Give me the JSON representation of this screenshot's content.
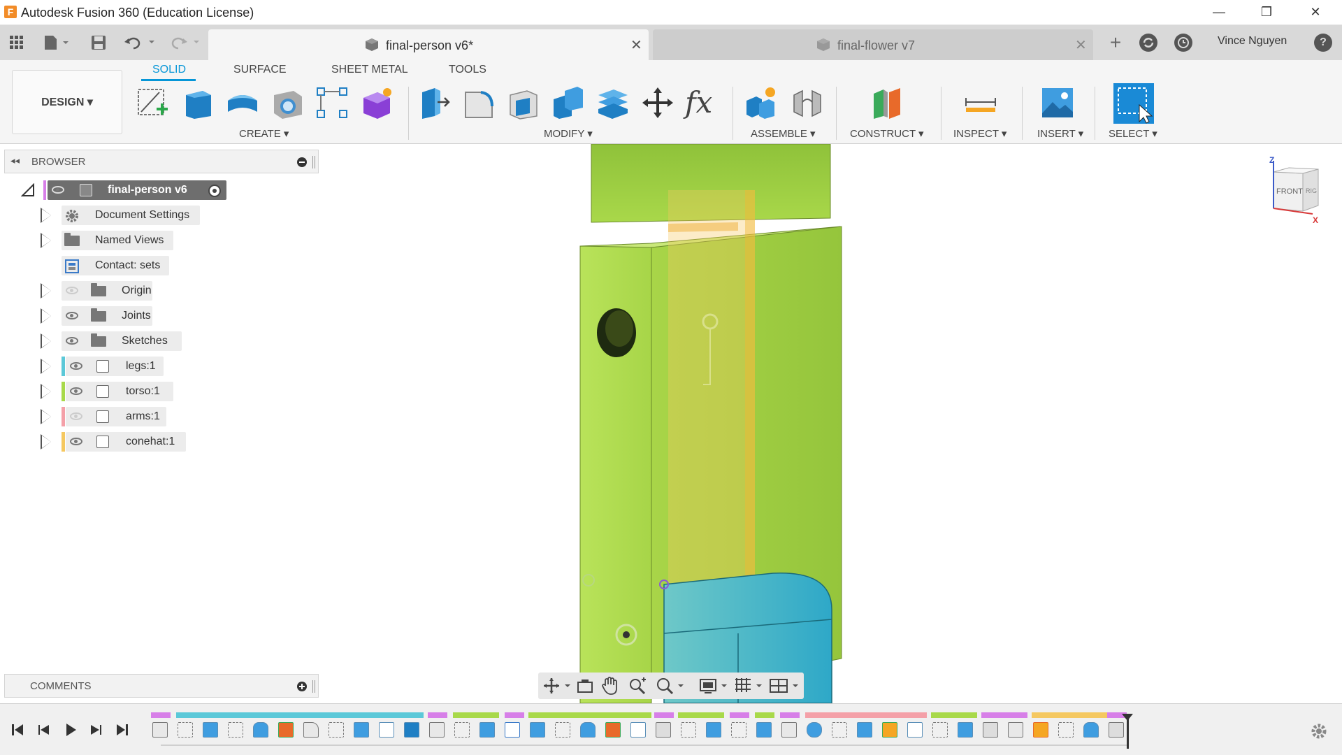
{
  "window": {
    "title": "Autodesk Fusion 360 (Education License)",
    "logo_letter": "F",
    "minimize_glyph": "—",
    "maximize_glyph": "❐",
    "close_glyph": "✕"
  },
  "tabs": [
    {
      "label": "final-person v6*",
      "active": true,
      "close_glyph": "✕"
    },
    {
      "label": "final-flower v7",
      "active": false,
      "close_glyph": "✕"
    }
  ],
  "tab_row": {
    "new_tab_glyph": "+",
    "user_name": "Vince Nguyen",
    "help_glyph": "?"
  },
  "mode_tabs": [
    {
      "label": "SOLID",
      "active": true
    },
    {
      "label": "SURFACE",
      "active": false
    },
    {
      "label": "SHEET METAL",
      "active": false
    },
    {
      "label": "TOOLS",
      "active": false
    }
  ],
  "workspace": {
    "label": "DESIGN ▾"
  },
  "tool_groups": {
    "create": "CREATE ▾",
    "modify": "MODIFY ▾",
    "assemble": "ASSEMBLE ▾",
    "construct": "CONSTRUCT ▾",
    "inspect": "INSPECT ▾",
    "insert": "INSERT ▾",
    "select": "SELECT ▾"
  },
  "modify_fx_glyph": "fx",
  "browser": {
    "title": "BROWSER",
    "root": "final-person v6",
    "items": [
      {
        "label": "Document Settings",
        "icon": "gear-icon"
      },
      {
        "label": "Named Views",
        "icon": "folder-icon"
      },
      {
        "label": "Contact: sets",
        "icon": "contact-set-icon"
      },
      {
        "label": "Origin",
        "icon": "folder-icon",
        "visible": false
      },
      {
        "label": "Joints",
        "icon": "folder-icon",
        "visible": true
      },
      {
        "label": "Sketches",
        "icon": "folder-icon",
        "visible": true
      },
      {
        "label": "legs:1",
        "icon": "component-icon",
        "visible": true,
        "color": "#5bc8d8"
      },
      {
        "label": "torso:1",
        "icon": "component-icon",
        "visible": true,
        "color": "#a8d94a"
      },
      {
        "label": "arms:1",
        "icon": "component-icon",
        "visible": false,
        "color": "#f4a0a8"
      },
      {
        "label": "conehat:1",
        "icon": "component-icon",
        "visible": true,
        "color": "#f5c860"
      }
    ]
  },
  "comments": {
    "title": "COMMENTS"
  },
  "viewcube": {
    "front_label": "FRONT",
    "right_label": "RIGHT",
    "z_label": "Z",
    "x_label": "X"
  },
  "colors": {
    "accent": "#0696d7",
    "torso_green": "#a8d94a",
    "legs_cyan": "#5bc8d8",
    "arms_pink": "#f4a0a8",
    "conehat_yellow": "#f5c860",
    "component_magenta": "#d77fe8"
  }
}
